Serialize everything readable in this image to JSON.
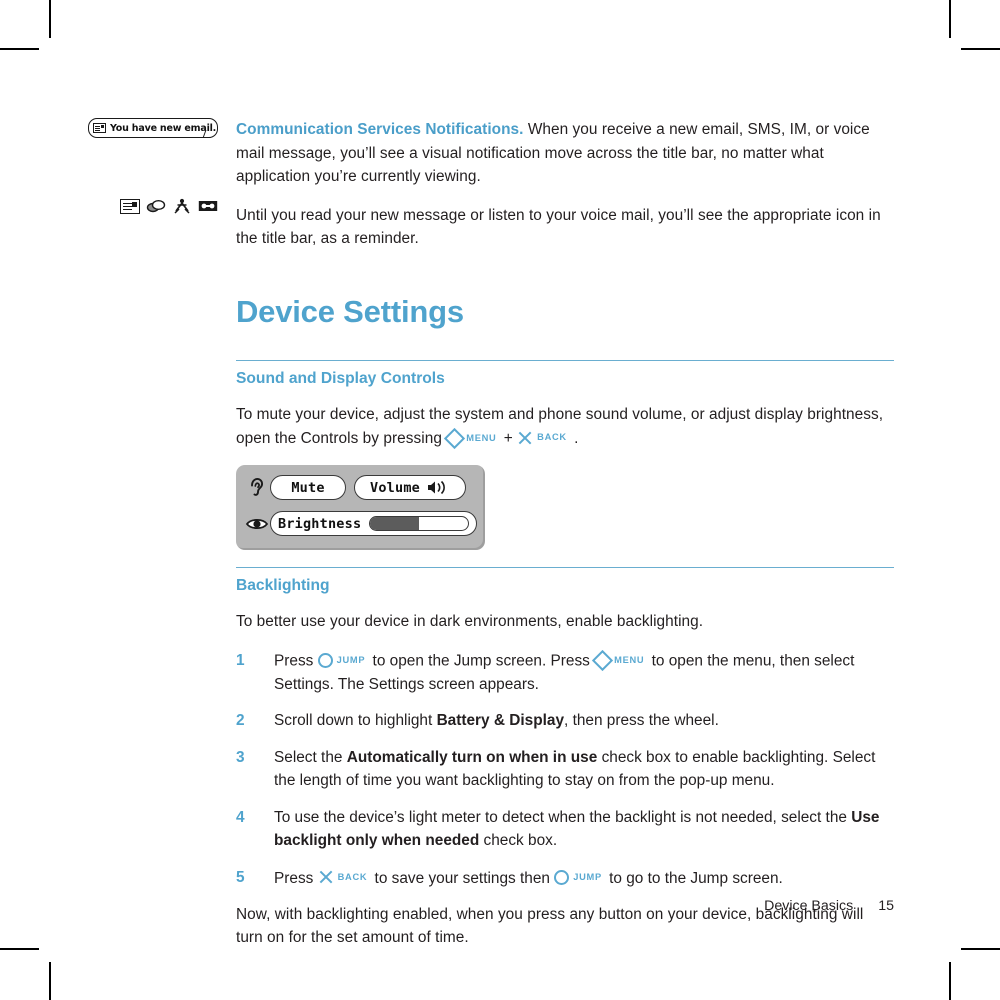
{
  "page": {
    "footer_section": "Device Basics",
    "footer_page_number": "15",
    "accent_color": "#4fa3cd",
    "body_color": "#231f20",
    "rule_color": "#6aaed0"
  },
  "margin_art": {
    "notification_bubble": {
      "text": "You have new email.",
      "icon": "envelope-icon"
    },
    "status_icons": [
      {
        "name": "email-icon",
        "label": "email"
      },
      {
        "name": "chat-bubbles-icon",
        "label": "instant message"
      },
      {
        "name": "sms-runner-icon",
        "label": "sms"
      },
      {
        "name": "voicemail-icon",
        "label": "voice mail"
      }
    ]
  },
  "body": {
    "p1_lead": "Communication Services Notifications.",
    "p1_rest": "When you receive a new email, SMS, IM, or voice mail message, you’ll see a visual notification move across the title bar, no matter what application you’re currently viewing.",
    "p2": "Until you read your new message or listen to your voice mail, you’ll see the appropriate icon in the title bar, as a reminder.",
    "chapter_heading": "Device Settings",
    "section1_heading": "Sound and Display Controls",
    "section1_p1_a": "To mute your device, adjust the system and phone sound volume, or adjust display brightness, open the Controls by pressing",
    "section1_p1_plus": "+",
    "section1_p1_end": ".",
    "section2_heading": "Backlighting",
    "section2_intro": "To better use your device in dark environments, enable backlighting.",
    "closing": "Now, with backlighting enabled, when you press any button on your device, backlighting will turn on for the set amount of time."
  },
  "keys": {
    "menu": "MENU",
    "back": "BACK",
    "jump": "JUMP"
  },
  "device_controls": {
    "mute_label": "Mute",
    "volume_label": "Volume",
    "brightness_label": "Brightness",
    "brightness_percent": 50,
    "ear_icon": "ear-icon",
    "eye_icon": "eye-icon",
    "speaker_icon": "speaker-icon"
  },
  "steps": [
    {
      "number": "1",
      "parts": [
        {
          "t": "text",
          "v": "Press "
        },
        {
          "t": "key",
          "glyph": "circle",
          "label": "JUMP"
        },
        {
          "t": "text",
          "v": " to open the Jump screen. Press "
        },
        {
          "t": "key",
          "glyph": "diamond",
          "label": "MENU"
        },
        {
          "t": "text",
          "v": " to open the menu, then select Settings. The Settings screen appears."
        }
      ]
    },
    {
      "number": "2",
      "parts": [
        {
          "t": "text",
          "v": "Scroll down to highlight "
        },
        {
          "t": "bold",
          "v": "Battery & Display"
        },
        {
          "t": "text",
          "v": ", then press the wheel."
        }
      ]
    },
    {
      "number": "3",
      "parts": [
        {
          "t": "text",
          "v": "Select the "
        },
        {
          "t": "bold",
          "v": "Automatically turn on when in use"
        },
        {
          "t": "text",
          "v": " check box to enable backlighting. Select the length of time you want backlighting to stay on from the pop-up menu."
        }
      ]
    },
    {
      "number": "4",
      "parts": [
        {
          "t": "text",
          "v": "To use the device’s light meter to detect when the backlight is not needed, select the "
        },
        {
          "t": "bold",
          "v": "Use backlight only when needed"
        },
        {
          "t": "text",
          "v": " check box."
        }
      ]
    },
    {
      "number": "5",
      "parts": [
        {
          "t": "text",
          "v": "Press "
        },
        {
          "t": "key",
          "glyph": "x",
          "label": "BACK"
        },
        {
          "t": "text",
          "v": " to save your settings then "
        },
        {
          "t": "key",
          "glyph": "circle",
          "label": "JUMP"
        },
        {
          "t": "text",
          "v": " to go to the Jump screen."
        }
      ]
    }
  ]
}
